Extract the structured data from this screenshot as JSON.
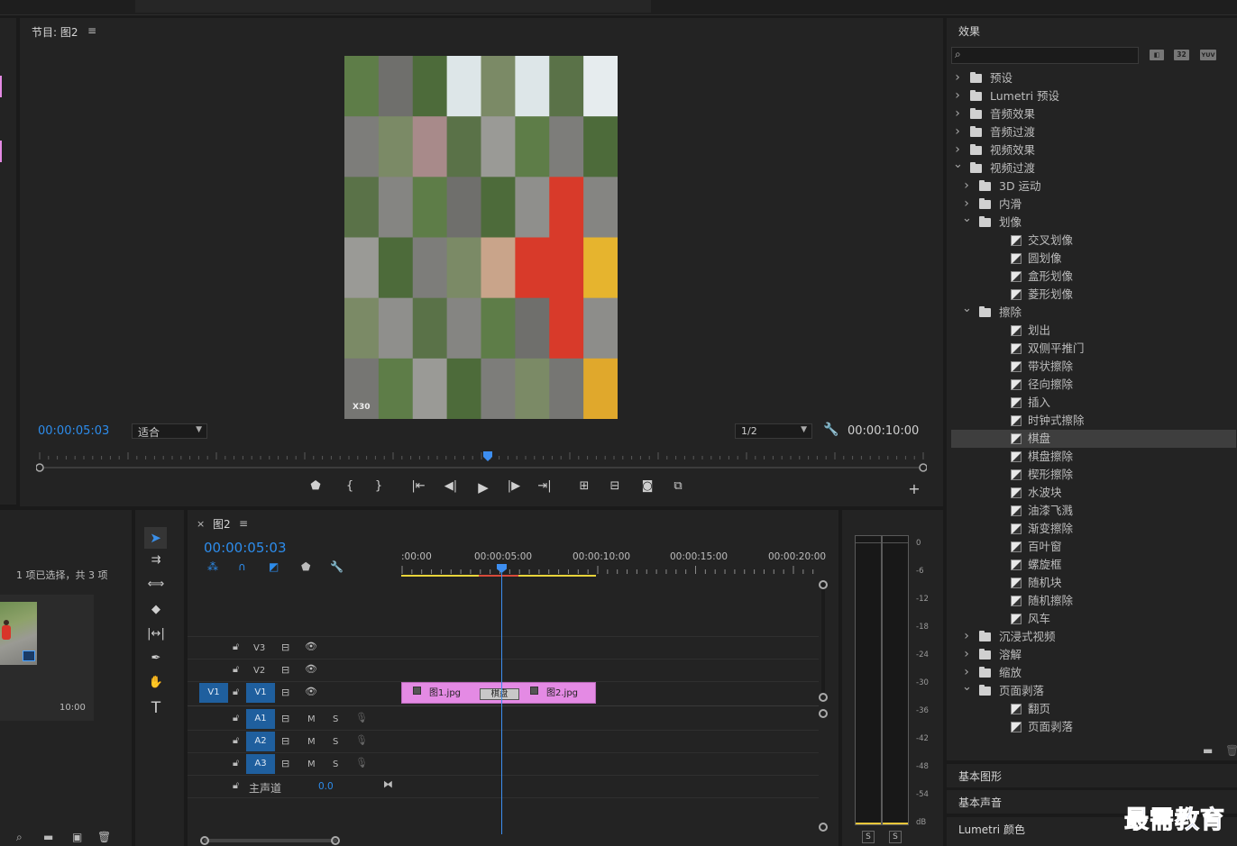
{
  "program": {
    "title": "节目: 图2",
    "timecode": "00:00:05:03",
    "fit": "适合",
    "quality": "1/2",
    "duration": "00:00:10:00",
    "watermark": "X30"
  },
  "project": {
    "selection": "1 项已选择，共 3 项",
    "thumb_duration": "10:00"
  },
  "timeline": {
    "tab_title": "图2",
    "timecode": "00:00:05:03",
    "ruler": [
      ":00:00",
      "00:00:05:00",
      "00:00:10:00",
      "00:00:15:00",
      "00:00:20:00"
    ],
    "tracks_video": [
      "V3",
      "V2",
      "V1"
    ],
    "source_v1": "V1",
    "tracks_audio": [
      "A1",
      "A2",
      "A3"
    ],
    "m": "M",
    "s": "S",
    "master": "主声道",
    "master_value": "0.0",
    "clip1": "图1.jpg",
    "clip2": "图2.jpg",
    "transition": "棋盘"
  },
  "meter": {
    "scale": [
      "0",
      "-6",
      "-12",
      "-18",
      "-24",
      "-30",
      "-36",
      "-42",
      "-48",
      "-54",
      "dB"
    ],
    "solo": [
      "S",
      "S"
    ]
  },
  "effects": {
    "title": "效果",
    "badges": [
      "32",
      "YUV"
    ],
    "items": [
      {
        "label": "预设",
        "level": 0,
        "type": "preset",
        "chev": ">"
      },
      {
        "label": "Lumetri 预设",
        "level": 0,
        "type": "preset",
        "chev": ">"
      },
      {
        "label": "音频效果",
        "level": 0,
        "type": "folder",
        "chev": ">"
      },
      {
        "label": "音频过渡",
        "level": 0,
        "type": "folder",
        "chev": ">"
      },
      {
        "label": "视频效果",
        "level": 0,
        "type": "folder",
        "chev": ">"
      },
      {
        "label": "视频过渡",
        "level": 0,
        "type": "folder",
        "chev": "v"
      },
      {
        "label": "3D 运动",
        "level": 1,
        "type": "folder",
        "chev": ">"
      },
      {
        "label": "内滑",
        "level": 1,
        "type": "folder",
        "chev": ">"
      },
      {
        "label": "划像",
        "level": 1,
        "type": "folder",
        "chev": "v"
      },
      {
        "label": "交叉划像",
        "level": 2,
        "type": "fx"
      },
      {
        "label": "圆划像",
        "level": 2,
        "type": "fx"
      },
      {
        "label": "盒形划像",
        "level": 2,
        "type": "fx"
      },
      {
        "label": "菱形划像",
        "level": 2,
        "type": "fx"
      },
      {
        "label": "擦除",
        "level": 1,
        "type": "folder",
        "chev": "v"
      },
      {
        "label": "划出",
        "level": 2,
        "type": "fx"
      },
      {
        "label": "双侧平推门",
        "level": 2,
        "type": "fx"
      },
      {
        "label": "带状擦除",
        "level": 2,
        "type": "fx"
      },
      {
        "label": "径向擦除",
        "level": 2,
        "type": "fx"
      },
      {
        "label": "插入",
        "level": 2,
        "type": "fx"
      },
      {
        "label": "时钟式擦除",
        "level": 2,
        "type": "fx"
      },
      {
        "label": "棋盘",
        "level": 2,
        "type": "fx",
        "selected": true
      },
      {
        "label": "棋盘擦除",
        "level": 2,
        "type": "fx"
      },
      {
        "label": "楔形擦除",
        "level": 2,
        "type": "fx"
      },
      {
        "label": "水波块",
        "level": 2,
        "type": "fx"
      },
      {
        "label": "油漆飞溅",
        "level": 2,
        "type": "fx"
      },
      {
        "label": "渐变擦除",
        "level": 2,
        "type": "fx"
      },
      {
        "label": "百叶窗",
        "level": 2,
        "type": "fx"
      },
      {
        "label": "螺旋框",
        "level": 2,
        "type": "fx"
      },
      {
        "label": "随机块",
        "level": 2,
        "type": "fx"
      },
      {
        "label": "随机擦除",
        "level": 2,
        "type": "fx"
      },
      {
        "label": "风车",
        "level": 2,
        "type": "fx"
      },
      {
        "label": "沉浸式视频",
        "level": 1,
        "type": "folder",
        "chev": ">"
      },
      {
        "label": "溶解",
        "level": 1,
        "type": "folder",
        "chev": ">"
      },
      {
        "label": "缩放",
        "level": 1,
        "type": "folder",
        "chev": ">"
      },
      {
        "label": "页面剥落",
        "level": 1,
        "type": "folder",
        "chev": "v"
      },
      {
        "label": "翻页",
        "level": 2,
        "type": "fx"
      },
      {
        "label": "页面剥落",
        "level": 2,
        "type": "fx"
      }
    ]
  },
  "bottom_panels": [
    "基本图形",
    "基本声音",
    "Lumetri 颜色"
  ],
  "brand": "最需教育",
  "colors": {
    "accent": "#2d8ceb",
    "clip": "#e48ae4",
    "track_target": "#1f5f9e",
    "selected_row": "#3e3e3e"
  }
}
